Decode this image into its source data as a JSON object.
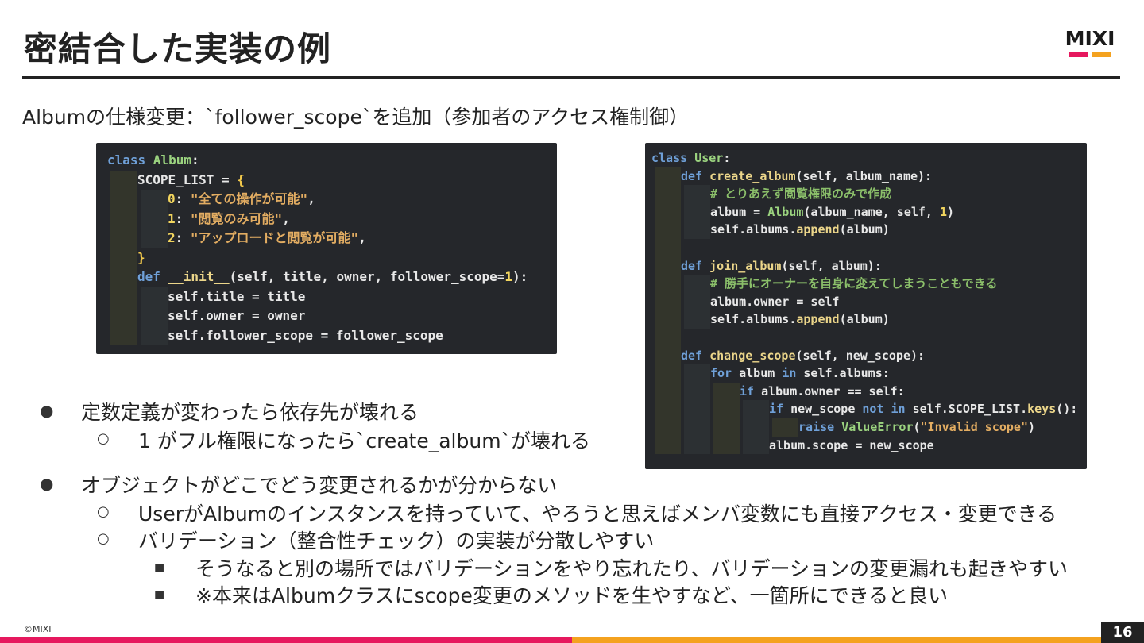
{
  "slide": {
    "title": "密結合した実装の例",
    "subtitle": "Albumの仕様変更：`follower_scope`を追加（参加者のアクセス権制御）",
    "logo_text": "MIXI",
    "copyright": "©MIXI",
    "page_number": "16"
  },
  "colors": {
    "logo_bar_left": "#e6185e",
    "logo_bar_right": "#f4a21f",
    "footer_left": "#e6185e",
    "footer_right": "#f4a21f",
    "code_bg": "#25272b"
  },
  "code_left": {
    "lines": [
      {
        "indent": 0,
        "parts": [
          [
            "kw",
            "class "
          ],
          [
            "cls",
            "Album"
          ],
          [
            "",
            "&#58;"
          ]
        ]
      },
      {
        "indent": 1,
        "parts": [
          [
            "",
            "SCOPE_LIST = "
          ],
          [
            "brace",
            "{"
          ]
        ]
      },
      {
        "indent": 2,
        "parts": [
          [
            "num",
            "0"
          ],
          [
            "",
            ": "
          ],
          [
            "str",
            "\"全ての操作が可能\""
          ],
          [
            "",
            ","
          ]
        ]
      },
      {
        "indent": 2,
        "parts": [
          [
            "num",
            "1"
          ],
          [
            "",
            ": "
          ],
          [
            "str",
            "\"閲覧のみ可能\""
          ],
          [
            "",
            ","
          ]
        ]
      },
      {
        "indent": 2,
        "parts": [
          [
            "num",
            "2"
          ],
          [
            "",
            ": "
          ],
          [
            "str",
            "\"アップロードと閲覧が可能\""
          ],
          [
            "",
            ","
          ]
        ]
      },
      {
        "indent": 1,
        "parts": [
          [
            "brace",
            "}"
          ]
        ]
      },
      {
        "indent": 1,
        "parts": [
          [
            "kw",
            "def "
          ],
          [
            "fn",
            "__init__"
          ],
          [
            "",
            "(self, title, owner, follower_scope="
          ],
          [
            "num",
            "1"
          ],
          [
            "",
            "):"
          ]
        ]
      },
      {
        "indent": 2,
        "parts": [
          [
            "",
            "self.title = title"
          ]
        ]
      },
      {
        "indent": 2,
        "parts": [
          [
            "",
            "self.owner = owner"
          ]
        ]
      },
      {
        "indent": 2,
        "parts": [
          [
            "",
            "self.follower_scope = follower_scope"
          ]
        ]
      }
    ]
  },
  "code_right": {
    "lines": [
      {
        "indent": 0,
        "parts": [
          [
            "kw",
            "class "
          ],
          [
            "cls",
            "User"
          ],
          [
            "",
            ":"
          ]
        ]
      },
      {
        "indent": 1,
        "parts": [
          [
            "kw",
            "def "
          ],
          [
            "fn",
            "create_album"
          ],
          [
            "",
            "(self, album_name):"
          ]
        ]
      },
      {
        "indent": 2,
        "parts": [
          [
            "cmt",
            "# とりあえず閲覧権限のみで作成"
          ]
        ]
      },
      {
        "indent": 2,
        "parts": [
          [
            "",
            "album = "
          ],
          [
            "cls",
            "Album"
          ],
          [
            "",
            "(album_name, self, "
          ],
          [
            "num",
            "1"
          ],
          [
            "",
            ")"
          ]
        ]
      },
      {
        "indent": 2,
        "parts": [
          [
            "",
            "self.albums."
          ],
          [
            "fn",
            "append"
          ],
          [
            "",
            "(album)"
          ]
        ]
      },
      {
        "indent": 1,
        "parts": [
          [
            "",
            ""
          ]
        ]
      },
      {
        "indent": 1,
        "parts": [
          [
            "kw",
            "def "
          ],
          [
            "fn",
            "join_album"
          ],
          [
            "",
            "(self, album):"
          ]
        ]
      },
      {
        "indent": 2,
        "parts": [
          [
            "cmt",
            "# 勝手にオーナーを自身に変えてしまうこともできる"
          ]
        ]
      },
      {
        "indent": 2,
        "parts": [
          [
            "",
            "album.owner = self"
          ]
        ]
      },
      {
        "indent": 2,
        "parts": [
          [
            "",
            "self.albums."
          ],
          [
            "fn",
            "append"
          ],
          [
            "",
            "(album)"
          ]
        ]
      },
      {
        "indent": 1,
        "parts": [
          [
            "",
            ""
          ]
        ]
      },
      {
        "indent": 1,
        "parts": [
          [
            "kw",
            "def "
          ],
          [
            "fn",
            "change_scope"
          ],
          [
            "",
            "(self, new_scope):"
          ]
        ]
      },
      {
        "indent": 2,
        "parts": [
          [
            "kw",
            "for "
          ],
          [
            "",
            "album "
          ],
          [
            "kw",
            "in "
          ],
          [
            "",
            "self.albums:"
          ]
        ]
      },
      {
        "indent": 3,
        "parts": [
          [
            "kw",
            "if "
          ],
          [
            "",
            "album.owner == self:"
          ]
        ]
      },
      {
        "indent": 4,
        "parts": [
          [
            "kw",
            "if "
          ],
          [
            "",
            "new_scope "
          ],
          [
            "kw",
            "not in "
          ],
          [
            "",
            "self.SCOPE_LIST."
          ],
          [
            "fn",
            "keys"
          ],
          [
            "",
            "():"
          ]
        ]
      },
      {
        "indent": 5,
        "parts": [
          [
            "kw",
            "raise "
          ],
          [
            "cls",
            "ValueError"
          ],
          [
            "",
            "("
          ],
          [
            "str",
            "\"Invalid scope\""
          ],
          [
            "",
            ")"
          ]
        ]
      },
      {
        "indent": 4,
        "parts": [
          [
            "",
            "album.scope = new_scope"
          ]
        ]
      }
    ]
  },
  "bullets": [
    {
      "level": 1,
      "marker": "●",
      "text": "定数定義が変わったら依存先が壊れる"
    },
    {
      "level": 2,
      "marker": "○",
      "text": "1 がフル権限になったら`create_album`が壊れる"
    },
    {
      "level": 1,
      "marker": "●",
      "text": "オブジェクトがどこでどう変更されるかが分からない"
    },
    {
      "level": 2,
      "marker": "○",
      "text": "UserがAlbumのインスタンスを持っていて、やろうと思えばメンバ変数にも直接アクセス・変更できる"
    },
    {
      "level": 2,
      "marker": "○",
      "text": "バリデーション（整合性チェック）の実装が分散しやすい"
    },
    {
      "level": 3,
      "marker": "■",
      "text": "そうなると別の場所ではバリデーションをやり忘れたり、バリデーションの変更漏れも起きやすい"
    },
    {
      "level": 3,
      "marker": "■",
      "text": "※本来はAlbumクラスにscope変更のメソッドを生やすなど、一箇所にできると良い"
    }
  ]
}
